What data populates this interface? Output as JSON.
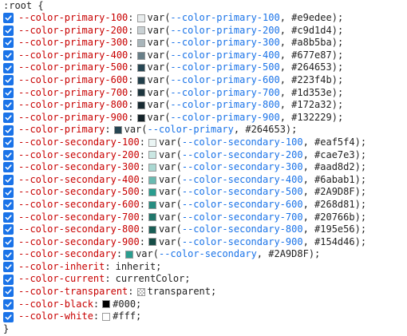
{
  "selector": ":root {",
  "closing": "}",
  "rules": [
    {
      "prop": "--color-primary-100",
      "swatch": "#e9edee",
      "fn": "var(",
      "var": "--color-primary-100",
      "fallback": ", #e9edee);"
    },
    {
      "prop": "--color-primary-200",
      "swatch": "#c9d1d4",
      "fn": "var(",
      "var": "--color-primary-200",
      "fallback": ", #c9d1d4);"
    },
    {
      "prop": "--color-primary-300",
      "swatch": "#a8b5ba",
      "fn": "var(",
      "var": "--color-primary-300",
      "fallback": ", #a8b5ba);"
    },
    {
      "prop": "--color-primary-400",
      "swatch": "#677e87",
      "fn": "var(",
      "var": "--color-primary-400",
      "fallback": ", #677e87);"
    },
    {
      "prop": "--color-primary-500",
      "swatch": "#264653",
      "fn": "var(",
      "var": "--color-primary-500",
      "fallback": ", #264653);"
    },
    {
      "prop": "--color-primary-600",
      "swatch": "#223f4b",
      "fn": "var(",
      "var": "--color-primary-600",
      "fallback": ", #223f4b);"
    },
    {
      "prop": "--color-primary-700",
      "swatch": "#1d353e",
      "fn": "var(",
      "var": "--color-primary-700",
      "fallback": ", #1d353e);"
    },
    {
      "prop": "--color-primary-800",
      "swatch": "#172a32",
      "fn": "var(",
      "var": "--color-primary-800",
      "fallback": ", #172a32);"
    },
    {
      "prop": "--color-primary-900",
      "swatch": "#132229",
      "fn": "var(",
      "var": "--color-primary-900",
      "fallback": ", #132229);"
    },
    {
      "prop": "--color-primary",
      "swatch": "#264653",
      "fn": "var(",
      "var": "--color-primary",
      "fallback": ", #264653);"
    },
    {
      "prop": "--color-secondary-100",
      "swatch": "#eaf5f4",
      "fn": "var(",
      "var": "--color-secondary-100",
      "fallback": ", #eaf5f4);"
    },
    {
      "prop": "--color-secondary-200",
      "swatch": "#cae7e3",
      "fn": "var(",
      "var": "--color-secondary-200",
      "fallback": ", #cae7e3);"
    },
    {
      "prop": "--color-secondary-300",
      "swatch": "#aad8d2",
      "fn": "var(",
      "var": "--color-secondary-300",
      "fallback": ", #aad8d2);"
    },
    {
      "prop": "--color-secondary-400",
      "swatch": "#6abab1",
      "fn": "var(",
      "var": "--color-secondary-400",
      "fallback": ", #6abab1);"
    },
    {
      "prop": "--color-secondary-500",
      "swatch": "#2A9D8F",
      "fn": "var(",
      "var": "--color-secondary-500",
      "fallback": ", #2A9D8F);"
    },
    {
      "prop": "--color-secondary-600",
      "swatch": "#268d81",
      "fn": "var(",
      "var": "--color-secondary-600",
      "fallback": ", #268d81);"
    },
    {
      "prop": "--color-secondary-700",
      "swatch": "#20766b",
      "fn": "var(",
      "var": "--color-secondary-700",
      "fallback": ", #20766b);"
    },
    {
      "prop": "--color-secondary-800",
      "swatch": "#195e56",
      "fn": "var(",
      "var": "--color-secondary-800",
      "fallback": ", #195e56);"
    },
    {
      "prop": "--color-secondary-900",
      "swatch": "#154d46",
      "fn": "var(",
      "var": "--color-secondary-900",
      "fallback": ", #154d46);"
    },
    {
      "prop": "--color-secondary",
      "swatch": "#2A9D8F",
      "fn": "var(",
      "var": "--color-secondary",
      "fallback": ", #2A9D8F);"
    },
    {
      "prop": "--color-inherit",
      "value": "inherit;"
    },
    {
      "prop": "--color-current",
      "value": "currentColor;"
    },
    {
      "prop": "--color-transparent",
      "swatch": "transparent",
      "value": "transparent;"
    },
    {
      "prop": "--color-black",
      "swatch": "#000",
      "value": "#000;"
    },
    {
      "prop": "--color-white",
      "swatch": "#fff",
      "value": "#fff;"
    }
  ],
  "colors": {
    "checkbox": "#1a73e8",
    "property": "#c80000",
    "variable": "#1a73e8"
  }
}
